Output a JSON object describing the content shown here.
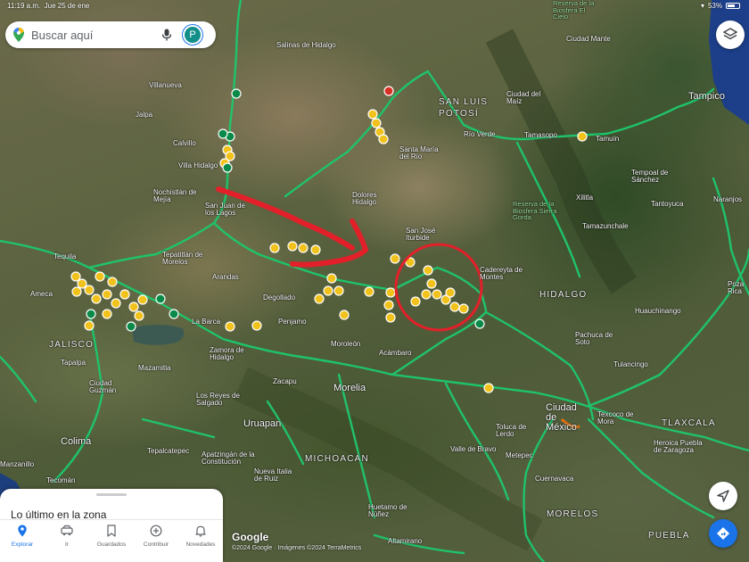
{
  "status_bar": {
    "time": "11:19 a.m.",
    "date": "Jue 25 de ene",
    "battery": "53%"
  },
  "search": {
    "placeholder": "Buscar aquí",
    "avatar_letter": "P"
  },
  "colors": {
    "route_green": "#1fc36a",
    "marker_yellow": "#f2c21c",
    "marker_green": "#0a8a48",
    "annotation_red": "#e3202a",
    "accent_blue": "#1a73e8"
  },
  "map": {
    "states": [
      "SAN LUIS POTOSÍ",
      "JALISCO",
      "HIDALGO",
      "MICHOACÁN",
      "TLAXCALA",
      "MORELOS",
      "PUEBLA"
    ],
    "cities": [
      "Salinas de Hidalgo",
      "Villanueva",
      "Jalpa",
      "Calvillo",
      "Villa Hidalgo",
      "Nochistlán de Mejía",
      "San Juan de los Lagos",
      "Tepatitlán de Morelos",
      "Tequila",
      "Ameca",
      "Arandas",
      "Degollado",
      "La Barca",
      "Penjamo",
      "Zamora de Hidalgo",
      "Zacapu",
      "Morelia",
      "Uruapan",
      "Moroleón",
      "Acámbaro",
      "Apatzingán de la Constitución",
      "Nueva Italia de Ruiz",
      "Huetamo de Núñez",
      "Altamirano",
      "Ciudad Guzmán",
      "Mazamitla",
      "Los Reyes de Salgado",
      "Tepalcatepec",
      "Tapalpa",
      "Colima",
      "Tecomán",
      "Manzanillo",
      "San Luis Potosí",
      "Santa María del Río",
      "Río Verde",
      "Ciudad del Maíz",
      "Ciudad Mante",
      "Tamuín",
      "Tamasopo",
      "Tampico",
      "Tempoal de Sánchez",
      "Xilitla",
      "Tamazunchale",
      "Cadereyta de Montes",
      "Pachuca de Soto",
      "Ciudad de México",
      "Texcoco de Mora",
      "Toluca de Lerdo",
      "Metepec",
      "Cuernavaca",
      "Heroica Puebla de Zaragoza",
      "Valle de Bravo",
      "Dolores Hidalgo",
      "San José Iturbide",
      "Poza Rica",
      "Huauchinango",
      "Naranjos",
      "Tantoyuca",
      "Tulancingo",
      "Reserva de la Biosfera El Cielo",
      "Reserva de la Biosfera Sierra Gorda"
    ]
  },
  "bottom_sheet": {
    "title": "Lo último en la zona"
  },
  "nav": [
    {
      "label": "Explorar",
      "icon": "location-pin-icon"
    },
    {
      "label": "Ir",
      "icon": "directions-car-icon"
    },
    {
      "label": "Guardados",
      "icon": "bookmark-icon"
    },
    {
      "label": "Contribuir",
      "icon": "add-circle-icon"
    },
    {
      "label": "Novedades",
      "icon": "bell-icon"
    }
  ],
  "footer": {
    "logo": "Google",
    "attribution": "©2024 Google · Imágenes ©2024 TerraMetrics"
  }
}
